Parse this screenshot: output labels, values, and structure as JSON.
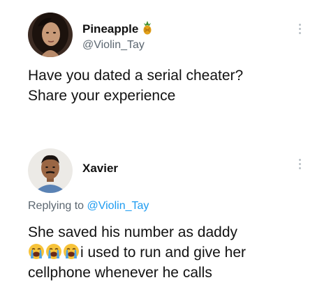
{
  "tweet_1": {
    "display_name": "Pineapple",
    "badge_icon": "pineapple-emoji-icon",
    "handle": "@Violin_Tay",
    "more_icon": "more-vertical-icon",
    "text_lines": [
      "Have you dated a serial cheater?",
      "Share your experience"
    ]
  },
  "tweet_2": {
    "display_name": "Xavier",
    "more_icon": "more-vertical-icon",
    "reply_prefix": "Replying to",
    "reply_mention": "@Violin_Tay",
    "text_line_1": "She saved his number as daddy",
    "emojis": [
      "loudly-crying-face-icon",
      "loudly-crying-face-icon",
      "loudly-crying-face-icon"
    ],
    "text_line_2_after_emojis": "i used to run and give her",
    "text_line_3": "cellphone whenever he calls"
  },
  "colors": {
    "text": "#111111",
    "secondary_text": "#5b6670",
    "link": "#1d9bf0",
    "background": "#ffffff"
  }
}
